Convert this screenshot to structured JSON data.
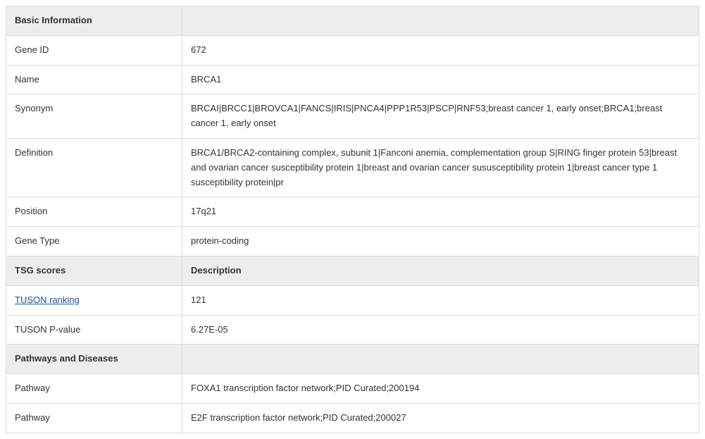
{
  "sections": {
    "basic": {
      "header": "Basic Information",
      "header2": ""
    },
    "tsg": {
      "header": "TSG scores",
      "header2": "Description"
    },
    "pathways": {
      "header": "Pathways and Diseases",
      "header2": ""
    }
  },
  "basic": {
    "gene_id": {
      "label": "Gene ID",
      "value": "672"
    },
    "name": {
      "label": "Name",
      "value": "BRCA1"
    },
    "synonym": {
      "label": "Synonym",
      "value": "BRCAI|BRCC1|BROVCA1|FANCS|IRIS|PNCA4|PPP1R53|PSCP|RNF53;breast cancer 1, early onset;BRCA1;breast cancer 1, early onset"
    },
    "definition": {
      "label": "Definition",
      "value": "BRCA1/BRCA2-containing complex, subunit 1|Fanconi anemia, complementation group S|RING finger protein 53|breast and ovarian cancer susceptibility protein 1|breast and ovarian cancer sususceptibility protein 1|breast cancer type 1 susceptibility protein|pr"
    },
    "position": {
      "label": "Position",
      "value": "17q21"
    },
    "gene_type": {
      "label": "Gene Type",
      "value": "protein-coding"
    }
  },
  "tsg": {
    "tuson_ranking": {
      "label": "TUSON ranking",
      "value": "121"
    },
    "tuson_pvalue": {
      "label": "TUSON P-value",
      "value": "6.27E-05"
    }
  },
  "pathways": {
    "p1": {
      "label": "Pathway",
      "value": "FOXA1 transcription factor network;PID Curated;200194"
    },
    "p2": {
      "label": "Pathway",
      "value": "E2F transcription factor network;PID Curated;200027"
    }
  }
}
